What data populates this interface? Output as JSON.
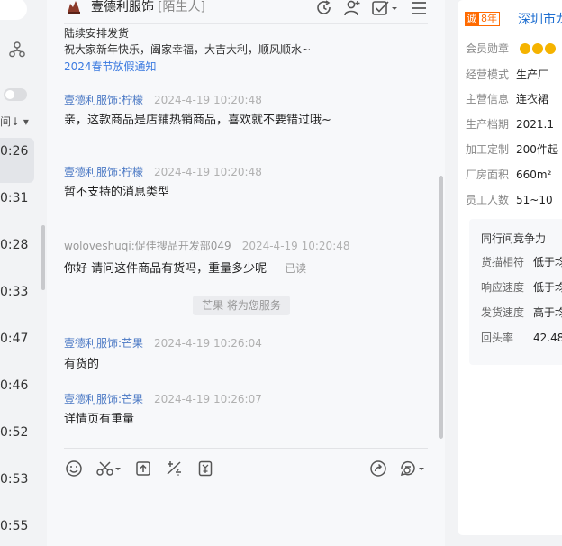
{
  "left": {
    "sort_label": "间↓ ▾",
    "times": [
      "0:26",
      "0:31",
      "0:28",
      "0:33",
      "0:47",
      "0:46",
      "0:52",
      "0:53",
      "0:55"
    ]
  },
  "chat": {
    "shop_name": "壹德利服饰",
    "stranger_tag": "[陌生人]",
    "pre_lines": [
      "陆续安排发货",
      "祝大家新年快乐，阖家幸福，大吉大利，顺风顺水~"
    ],
    "notice_link": "2024春节放假通知",
    "messages": [
      {
        "sender": "壹德利服饰:柠檬",
        "time": "2024-4-19 10:20:48",
        "text": "亲，这款商品是店铺热销商品，喜欢就不要错过哦~"
      },
      {
        "sender": "壹德利服饰:柠檬",
        "time": "2024-4-19 10:20:48",
        "text": "暂不支持的消息类型"
      },
      {
        "sender": "woloveshuqi:促佳搜品开发部049",
        "time": "2024-4-19 10:20:48",
        "text": "你好 请问这件商品有货吗，重量多少呢",
        "status": "已读"
      },
      {
        "sender": "壹德利服饰:芒果",
        "time": "2024-4-19 10:26:04",
        "text": "有货的"
      },
      {
        "sender": "壹德利服饰:芒果",
        "time": "2024-4-19 10:26:07",
        "text": "详情页有重量"
      }
    ],
    "system_notice": "芒果 将为您服务"
  },
  "right": {
    "badge_years": "8年",
    "city": "深圳市龙",
    "rows": [
      {
        "label": "会员勋章",
        "value": ""
      },
      {
        "label": "经营模式",
        "value": "生产厂"
      },
      {
        "label": "主营信息",
        "value": "连衣裙"
      },
      {
        "label": "生产档期",
        "value": "2021.1"
      },
      {
        "label": "加工定制",
        "value": "200件起"
      },
      {
        "label": "厂房面积",
        "value": "660m²"
      },
      {
        "label": "员工人数",
        "value": "51~10"
      }
    ],
    "compete_title": "同行间竞争力",
    "compete_rows": [
      {
        "label": "货描相符",
        "value": "低于均"
      },
      {
        "label": "响应速度",
        "value": "低于均"
      },
      {
        "label": "发货速度",
        "value": "高于均"
      },
      {
        "label": "回头率",
        "value": "42.48"
      }
    ]
  },
  "colors": {
    "accent_blue": "#3d7be0",
    "sender_blue": "#4a78c4",
    "orange": "#ff6a00"
  }
}
